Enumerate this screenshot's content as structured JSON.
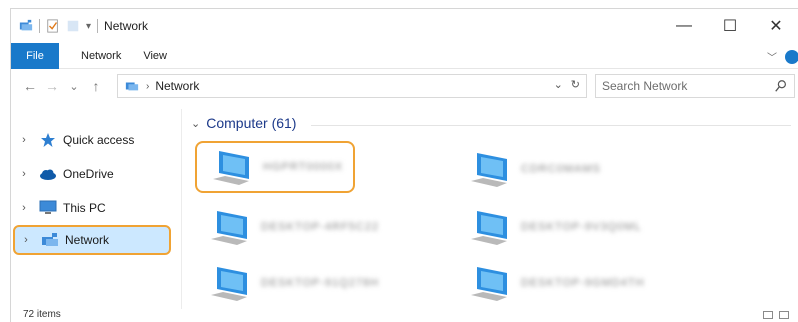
{
  "window": {
    "title": "Network",
    "minimize": "—",
    "maximize": "☐",
    "close": "✕"
  },
  "ribbon": {
    "tabs": [
      "File",
      "Network",
      "View"
    ],
    "collapse_chevron": "﹀"
  },
  "address": {
    "back": "←",
    "forward": "→",
    "recent": "⌄",
    "up": "↑",
    "crumb_separator": "›",
    "location": "Network",
    "dropdown": "⌄",
    "refresh": "↻",
    "search_placeholder": "Search Network"
  },
  "nav": {
    "items": [
      {
        "label": "Quick access",
        "icon": "star-icon",
        "expand": "›"
      },
      {
        "label": "OneDrive",
        "icon": "cloud-icon",
        "expand": "›"
      },
      {
        "label": "This PC",
        "icon": "monitor-icon",
        "expand": "›"
      },
      {
        "label": "Network",
        "icon": "network-icon",
        "expand": "›",
        "selected": true
      }
    ]
  },
  "content": {
    "group_label": "Computer (61)",
    "group_chevron": "⌄",
    "computers": [
      {
        "name": "HGPRT0000X",
        "highlighted": true
      },
      {
        "name": "CDRC0MAMS"
      },
      {
        "name": "DESKTOP-4RF5C22"
      },
      {
        "name": "DESKTOP-9V3Q0ML"
      },
      {
        "name": "DESKTOP-91Q278H"
      },
      {
        "name": "DESKTOP-9GMD4TH"
      }
    ]
  },
  "status": {
    "item_count": "72 items"
  },
  "colors": {
    "accent": "#1979ca",
    "highlight_outline": "#f0a334",
    "selection_fill": "#cce8ff"
  }
}
